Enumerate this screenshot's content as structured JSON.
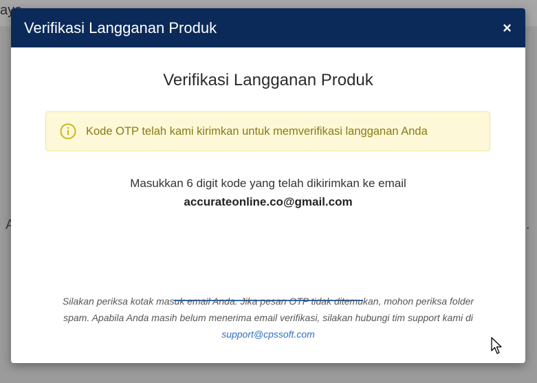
{
  "background": {
    "top_fragment": "aya",
    "left_fragment": "A",
    "right_fragment": "."
  },
  "modal": {
    "header_title": "Verifikasi Langganan Produk",
    "close_label": "×",
    "body_title": "Verifikasi Langganan Produk",
    "alert": {
      "icon": "info-circle-icon",
      "text": "Kode OTP telah kami kirimkan untuk memverifikasi langganan Anda"
    },
    "instruction": "Masukkan 6 digit kode yang telah dikirimkan ke email",
    "email": "accurateonline.co@gmail.com",
    "otp_input": {
      "value": "",
      "placeholder": ""
    },
    "note": {
      "text_line1": "Silakan periksa kotak masuk email Anda. Jika pesan OTP tidak ditemukan, mohon periksa folder",
      "text_line2": "spam. Apabila Anda masih belum menerima email verifikasi, silakan hubungi tim support kami di",
      "link_text": "support@cpssoft.com"
    }
  },
  "colors": {
    "header_bg": "#0b2a59",
    "alert_bg": "#fdf8d8",
    "alert_text": "#8a7a12",
    "link": "#2f6fc0",
    "input_underline": "#2a66b8"
  }
}
